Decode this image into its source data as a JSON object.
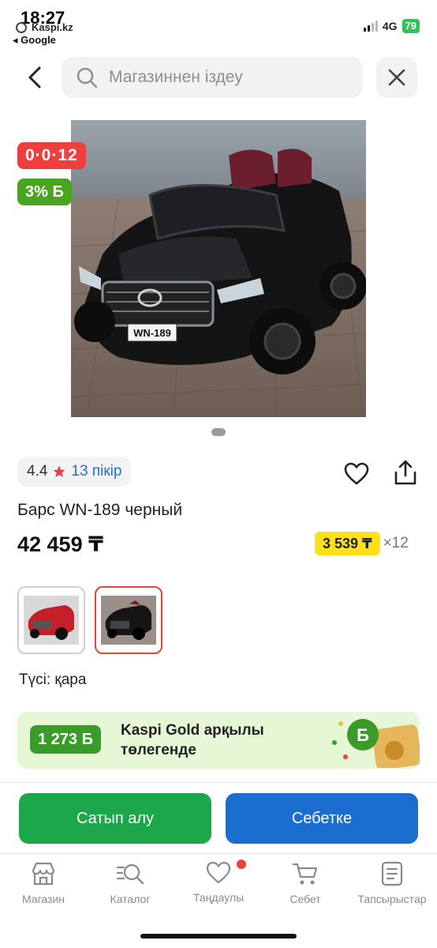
{
  "status": {
    "time": "18:27",
    "overlay_app": "Kaspi.kz",
    "back_app": "◂ Google",
    "network": "4G",
    "battery": "79"
  },
  "search": {
    "placeholder": "Магазиннен іздеу"
  },
  "product": {
    "badge_installment": "0·0·12",
    "badge_bonus": "3% Б",
    "rating": "4.4",
    "reviews": "13 пікір",
    "title": "Барс WN-189 черный",
    "price": "42 459 ₸",
    "installment_amount": "3 539 ₸",
    "installment_mult": "×12",
    "plate": "WN-189",
    "color_label": "Түсі: қара"
  },
  "gold": {
    "amount": "1 273 Б",
    "text": "Kaspi Gold арқылы төлегенде"
  },
  "actions": {
    "buy": "Сатып алу",
    "cart": "Себетке"
  },
  "tabs": [
    {
      "label": "Магазин",
      "icon": "store-icon"
    },
    {
      "label": "Каталог",
      "icon": "catalog-icon"
    },
    {
      "label": "Таңдаулы",
      "icon": "heart-icon"
    },
    {
      "label": "Себет",
      "icon": "cart-icon"
    },
    {
      "label": "Тапсырыстар",
      "icon": "orders-icon"
    }
  ],
  "colors": {
    "red_badge": "#f03e3e",
    "green_badge": "#49a51f",
    "yellow_installment": "#ffe01b",
    "buy_button": "#1ca84a",
    "cart_button": "#1b6dd0",
    "link_blue": "#1e6fce"
  }
}
